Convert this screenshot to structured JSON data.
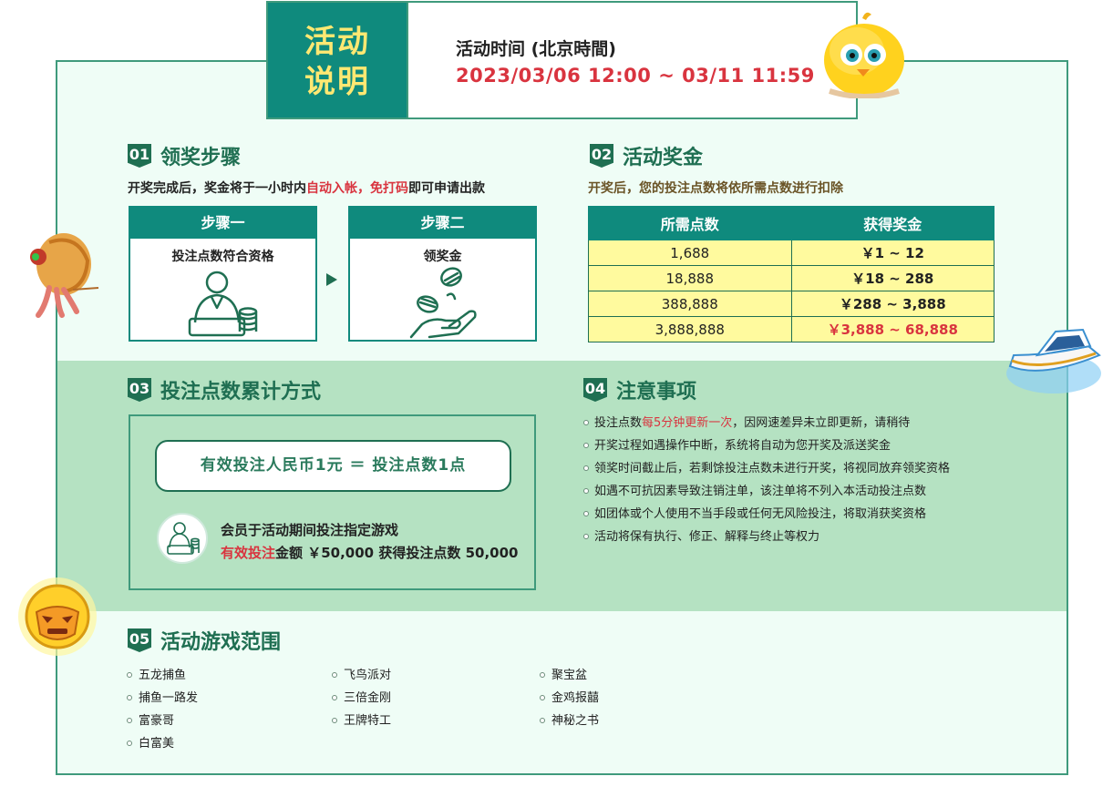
{
  "header": {
    "title_line1": "活动",
    "title_line2": "说明",
    "time_label": "活动时间 (北京時間)",
    "time_range": "2023/03/06 12:00 ~ 03/11 11:59"
  },
  "sec1": {
    "num": "01",
    "title": "领奖步骤",
    "note_a": "开奖完成后，奖金将于一小时内",
    "note_b": "自动入帐，免打码",
    "note_c": "即可申请出款",
    "steps": [
      {
        "head": "步骤一",
        "desc": "投注点数符合资格",
        "icon": "person-coins-icon"
      },
      {
        "head": "步骤二",
        "desc": "领奖金",
        "icon": "hand-coins-icon"
      }
    ]
  },
  "sec2": {
    "num": "02",
    "title": "活动奖金",
    "note": "开奖后，您的投注点数将依所需点数进行扣除",
    "col1": "所需点数",
    "col2": "获得奖金",
    "rows": [
      {
        "points": "1,688",
        "bonus": "￥1 ~ 12"
      },
      {
        "points": "18,888",
        "bonus": "￥18 ~ 288"
      },
      {
        "points": "388,888",
        "bonus": "￥288 ~ 3,888"
      },
      {
        "points": "3,888,888",
        "bonus": "￥3,888 ~ 68,888"
      }
    ]
  },
  "sec3": {
    "num": "03",
    "title": "投注点数累计方式",
    "formula": "有效投注人民币1元 ＝ 投注点数1点",
    "example_line1": "会员于活动期间投注指定游戏",
    "example_red": "有效投注",
    "example_rest": "金额 ￥50,000 获得投注点数 50,000"
  },
  "sec4": {
    "num": "04",
    "title": "注意事项",
    "note1_a": "投注点数",
    "note1_red": "每5分钟更新一次",
    "note1_b": "，因网速差异未立即更新，请稍待",
    "notes": [
      "开奖过程如遇操作中断，系统将自动为您开奖及派送奖金",
      "领奖时间截止后，若剩馀投注点数未进行开奖，将视同放弃领奖资格",
      "如遇不可抗因素导致注销注单，该注单将不列入本活动投注点数",
      "如团体或个人使用不当手段或任何无风险投注，将取消获奖资格",
      "活动将保有执行、修正、解释与终止等权力"
    ]
  },
  "sec5": {
    "num": "05",
    "title": "活动游戏范围",
    "col1": [
      "五龙捕鱼",
      "捕鱼一路发",
      "富豪哥",
      "白富美"
    ],
    "col2": [
      "飞鸟派对",
      "三倍金刚",
      "王牌特工"
    ],
    "col3": [
      "聚宝盆",
      "金鸡报囍",
      "神秘之书"
    ]
  },
  "colors": {
    "teal": "#0f8a7d",
    "dark_green": "#1f6f52",
    "red": "#d9343f",
    "yellow": "#fffa9e",
    "band": "#b5e2c2"
  }
}
